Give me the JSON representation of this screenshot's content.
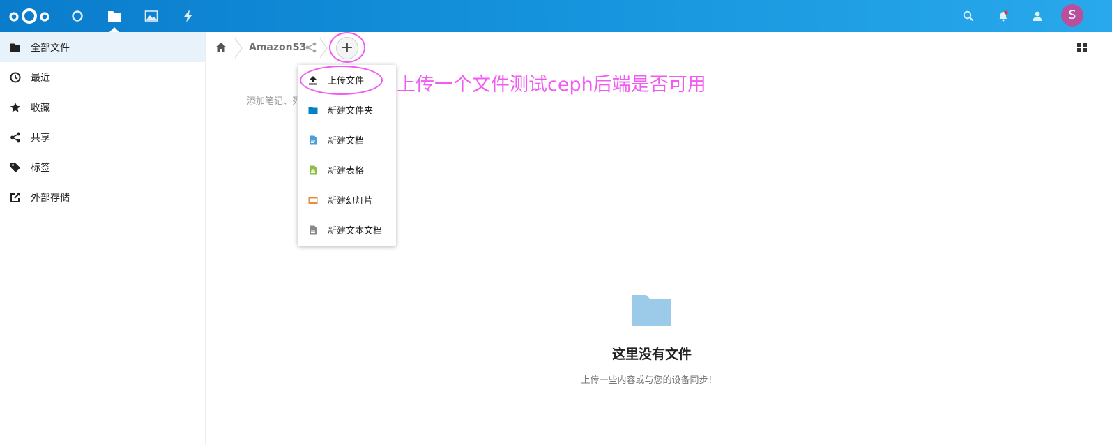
{
  "header": {
    "apps": [
      "logo",
      "dashboard",
      "files",
      "photos",
      "activity"
    ],
    "avatar_letter": "S",
    "colors": {
      "header_gradient_start": "#0a7ccc",
      "header_gradient_end": "#29a9ec",
      "avatar": "#b8509d"
    }
  },
  "sidebar": {
    "items": [
      {
        "label": "全部文件",
        "icon": "folder-icon",
        "active": true
      },
      {
        "label": "最近",
        "icon": "clock-icon"
      },
      {
        "label": "收藏",
        "icon": "star-icon"
      },
      {
        "label": "共享",
        "icon": "share-icon"
      },
      {
        "label": "标签",
        "icon": "tag-icon"
      },
      {
        "label": "外部存储",
        "icon": "external-link-icon"
      }
    ]
  },
  "breadcrumb": {
    "folder": "AmazonS3",
    "add_label": "+"
  },
  "rich_workspace": {
    "placeholder": "添加笔记、列表或链接…"
  },
  "new_menu": {
    "items": [
      {
        "label": "上传文件",
        "icon": "upload-icon"
      },
      {
        "label": "新建文件夹",
        "icon": "folder-icon"
      },
      {
        "label": "新建文档",
        "icon": "document-icon"
      },
      {
        "label": "新建表格",
        "icon": "spreadsheet-icon"
      },
      {
        "label": "新建幻灯片",
        "icon": "presentation-icon"
      },
      {
        "label": "新建文本文档",
        "icon": "text-file-icon"
      }
    ]
  },
  "empty_state": {
    "title": "这里没有文件",
    "subtitle": "上传一些内容或与您的设备同步！"
  },
  "annotation": {
    "text": "上传一个文件测试ceph后端是否可用",
    "color": "#f25bf2"
  }
}
